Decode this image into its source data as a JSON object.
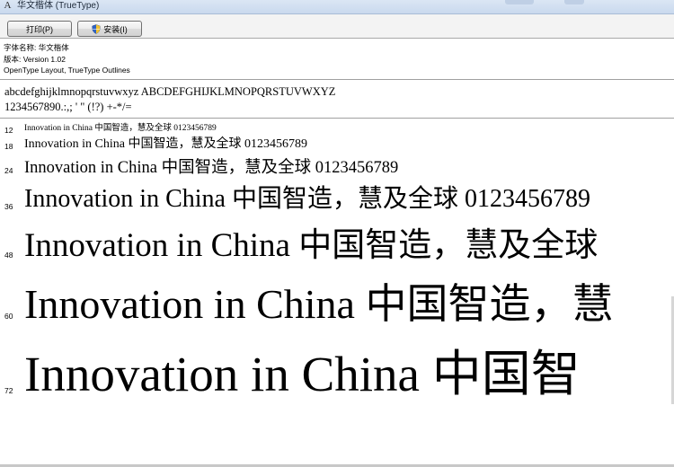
{
  "window": {
    "title": "华文楷体 (TrueType)",
    "app_icon": "font-file-icon",
    "app_icon_glyph": "A"
  },
  "toolbar": {
    "print_label": "打印(P)",
    "install_label": "安装(I)",
    "install_icon": "shield-icon"
  },
  "info": {
    "font_name": "字体名称: 华文楷体",
    "version": "版本: Version 1.02",
    "outlines": "OpenType Layout, TrueType Outlines"
  },
  "charset": {
    "letters": "abcdefghijklmnopqrstuvwxyz ABCDEFGHIJKLMNOPQRSTUVWXYZ",
    "digits_symbols": "1234567890.:,; ' \" (!?) +-*/="
  },
  "samples": [
    {
      "size": "12",
      "text": "Innovation in China 中国智造，慧及全球 0123456789"
    },
    {
      "size": "18",
      "text": "Innovation in China 中国智造，慧及全球 0123456789"
    },
    {
      "size": "24",
      "text": "Innovation in China 中国智造，慧及全球 0123456789"
    },
    {
      "size": "36",
      "text": "Innovation in China 中国智造，慧及全球 0123456789"
    },
    {
      "size": "48",
      "text": "Innovation in China 中国智造，慧及全球"
    },
    {
      "size": "60",
      "text": "Innovation in China 中国智造，慧"
    },
    {
      "size": "72",
      "text": "Innovation in China 中国智"
    }
  ],
  "colors": {
    "titlebar": "#c9d9ee",
    "toolbar": "#f3f3f3",
    "background": "#ffffff",
    "separator": "#a0a0a0"
  }
}
